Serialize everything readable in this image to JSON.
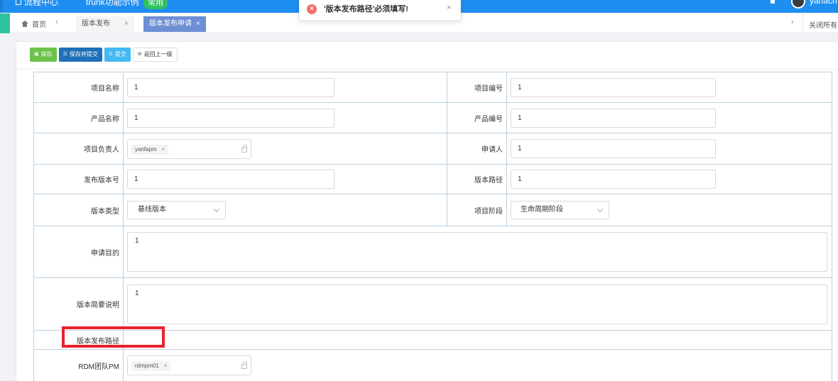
{
  "topbar": {
    "items": [
      "流程中心",
      "trunk功能示例"
    ],
    "badge": "常用",
    "username": "yanach"
  },
  "tabs": {
    "home": "首页",
    "prev": "‹",
    "next": "›",
    "items": [
      {
        "label": "版本发布",
        "close": "×"
      },
      {
        "label": "版本发布申请",
        "close": "×"
      }
    ],
    "close_all": "关闭所有"
  },
  "toolbar": {
    "save": "保存",
    "save_submit": "保存并提交",
    "submit": "提交",
    "back": "返回上一级"
  },
  "toast": {
    "icon": "×",
    "message": "'版本发布路径'必须填写!",
    "close": "×"
  },
  "form": {
    "project_name": {
      "label": "项目名称",
      "value": "1"
    },
    "project_code": {
      "label": "项目编号",
      "value": "1"
    },
    "product_name": {
      "label": "产品名称",
      "value": "1"
    },
    "product_code": {
      "label": "产品编号",
      "value": "1"
    },
    "project_owner": {
      "label": "项目负责人",
      "tag": "yanfapm",
      "tag_close": "×"
    },
    "applicant": {
      "label": "申请人",
      "value": "1"
    },
    "release_version": {
      "label": "发布版本号",
      "value": "1"
    },
    "version_path": {
      "label": "版本路径",
      "value": "1"
    },
    "version_type": {
      "label": "版本类型",
      "value": "基线版本"
    },
    "project_stage": {
      "label": "项目阶段",
      "value": "生命周期阶段"
    },
    "purpose": {
      "label": "申请目的",
      "value": "1"
    },
    "summary": {
      "label": "版本简要说明",
      "value": "1"
    },
    "release_path": {
      "label": "版本发布路径",
      "value": ""
    },
    "rdm_pm": {
      "label": "RDM团队PM",
      "tag": "rdmpm01",
      "tag_close": "×"
    }
  }
}
